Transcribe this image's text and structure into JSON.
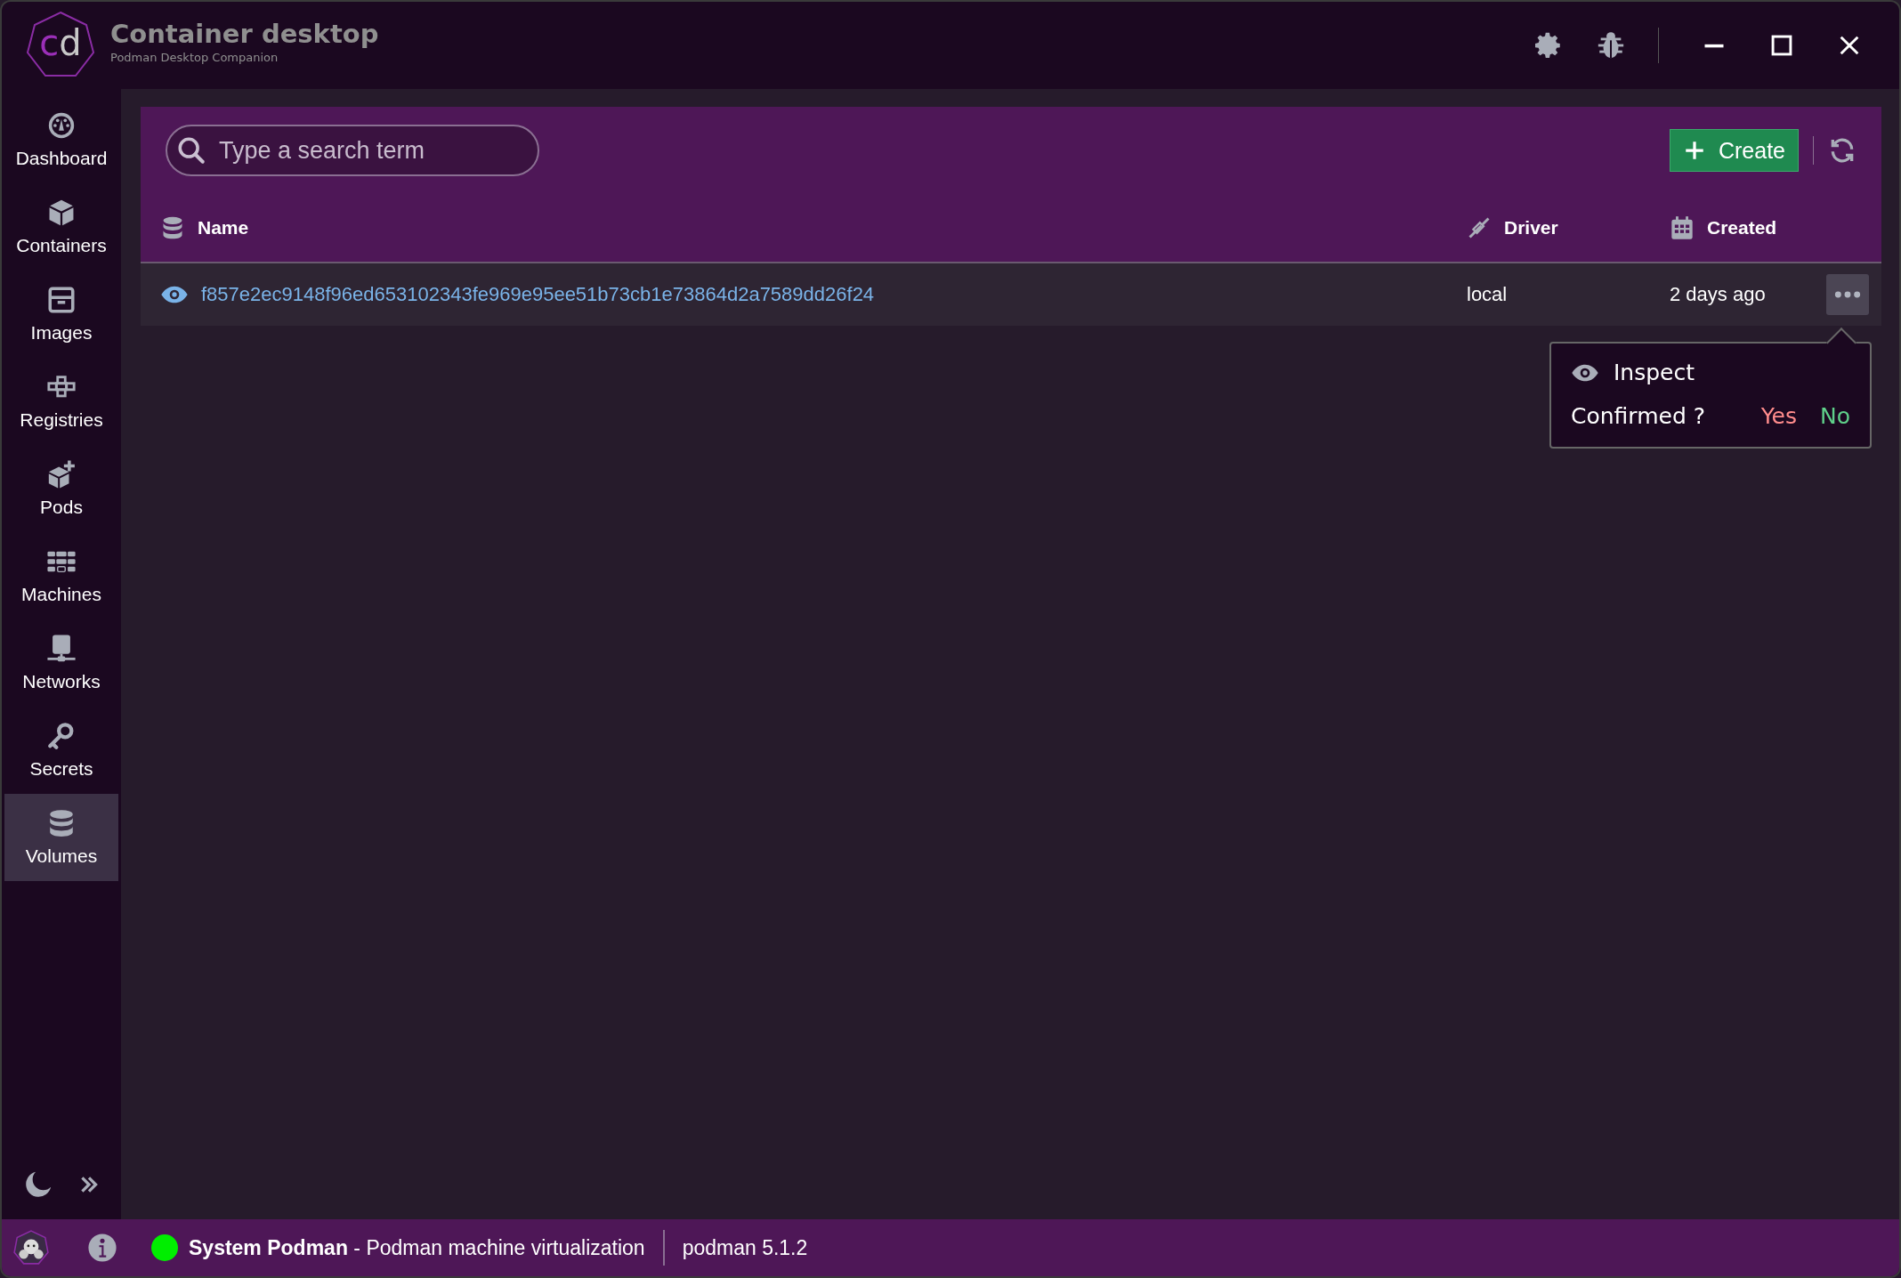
{
  "app": {
    "logo": [
      {
        "letter": "c",
        "color": "#9b2fb8"
      },
      {
        "letter": "d",
        "color": "#c8c8c8"
      }
    ],
    "title": "Container desktop",
    "subtitle": "Podman Desktop Companion"
  },
  "sidebar": {
    "items": [
      {
        "label": "Dashboard",
        "selected": false
      },
      {
        "label": "Containers",
        "selected": false
      },
      {
        "label": "Images",
        "selected": false
      },
      {
        "label": "Registries",
        "selected": false
      },
      {
        "label": "Pods",
        "selected": false
      },
      {
        "label": "Machines",
        "selected": false
      },
      {
        "label": "Networks",
        "selected": false
      },
      {
        "label": "Secrets",
        "selected": false
      },
      {
        "label": "Volumes",
        "selected": true
      }
    ]
  },
  "search": {
    "placeholder": "Type a search term"
  },
  "create_button": "Create",
  "table": {
    "columns": [
      "Name",
      "Driver",
      "Created"
    ],
    "rows": [
      {
        "name": "f857e2ec9148f96ed653102343fe969e95ee51b73cb1e73864d2a7589dd26f24",
        "driver": "local",
        "created": "2 days ago"
      }
    ]
  },
  "popup": {
    "action": "Inspect",
    "question": "Confirmed ?",
    "yes": "Yes",
    "no": "No"
  },
  "status_bar": {
    "connection": {
      "color": "#00ee00",
      "text": "**System Podman** - Podman machine virtualization"
    },
    "version": "podman 5.1.2"
  }
}
